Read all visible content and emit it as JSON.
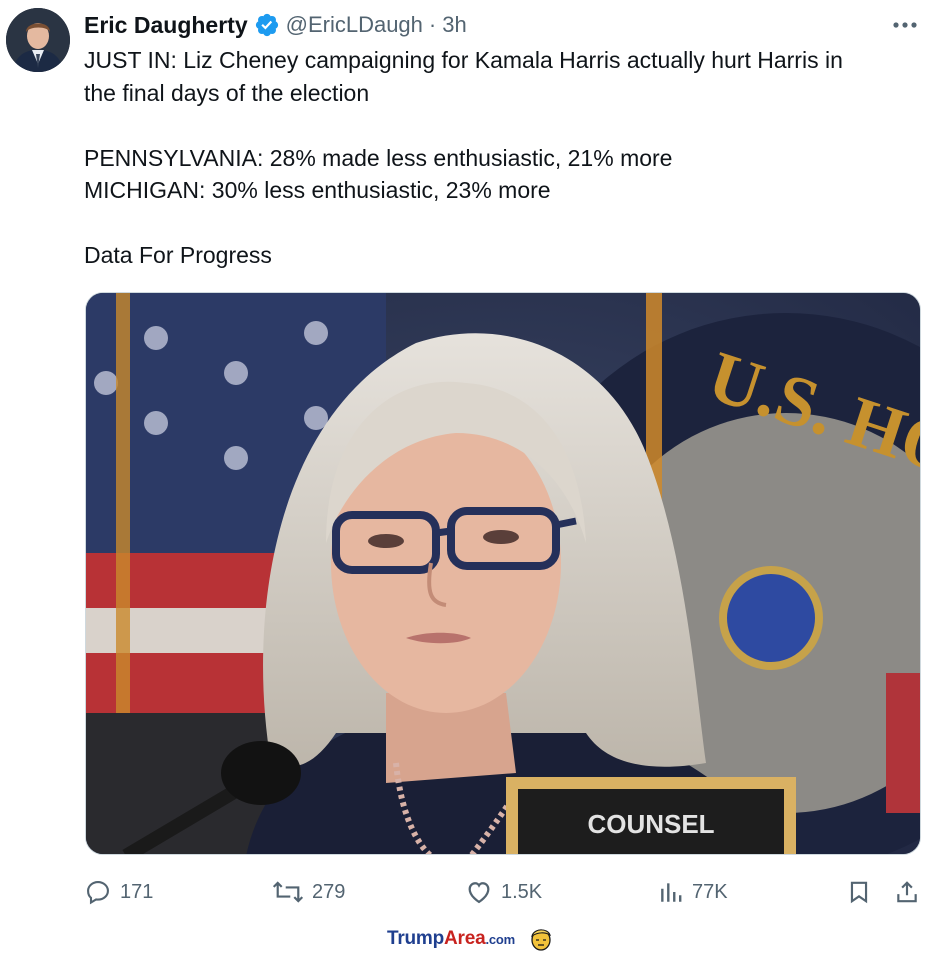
{
  "author": {
    "name": "Eric Daugherty",
    "handle": "@EricLDaugh",
    "separator": "·",
    "time": "3h",
    "verified_color": "#1d9bf0"
  },
  "tweet": {
    "line1": "JUST IN: Liz Cheney campaigning for Kamala Harris actually hurt Harris in",
    "line2": "the final days of the election",
    "line3": "PENNSYLVANIA: 28% made less enthusiastic, 21% more",
    "line4": "MICHIGAN: 30% less enthusiastic, 23% more",
    "line5": "Data For Progress"
  },
  "media": {
    "placard_text": "COUNSEL"
  },
  "actions": {
    "replies": "171",
    "reposts": "279",
    "likes": "1.5K",
    "views": "77K"
  },
  "footer": {
    "brand_part1": "Trump",
    "brand_part2": "Area",
    "brand_part3": ".com"
  },
  "colors": {
    "text": "#0f1419",
    "secondary": "#536471",
    "brand_blue": "#1f3f8f",
    "brand_red": "#c8231f"
  }
}
